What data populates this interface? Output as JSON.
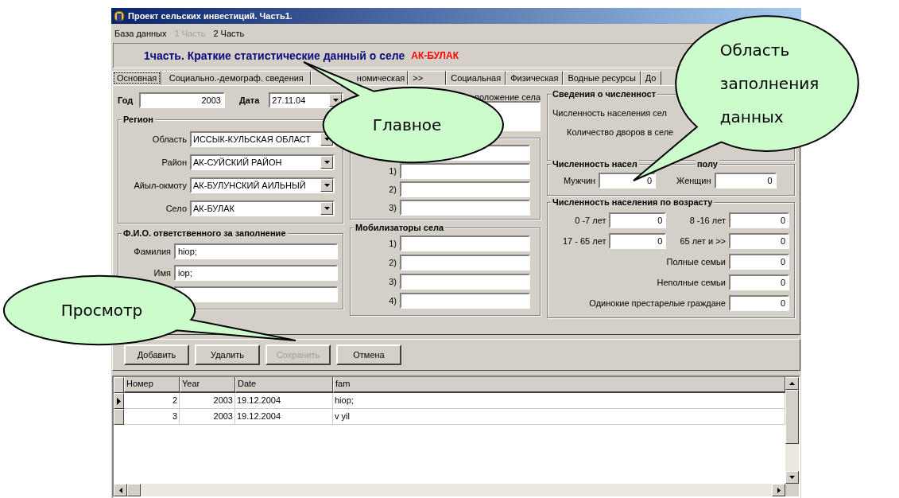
{
  "window": {
    "title": "Проект сельских инвестиций. Часть1."
  },
  "menu": [
    {
      "label": "База данных",
      "disabled": false
    },
    {
      "label": "1 Часть",
      "disabled": true
    },
    {
      "label": "2 Часть",
      "disabled": false
    }
  ],
  "header": {
    "text": "1часть. Краткие статистические данный о селе",
    "village": "АК-БУЛАК"
  },
  "tabs": [
    {
      "label": "Основная",
      "selected": true
    },
    {
      "label": "Социально.-демограф. сведения",
      "selected": false
    },
    {
      "label": "номическая",
      "selected": false
    },
    {
      "label": ">>",
      "selected": false
    },
    {
      "label": "Социальная",
      "selected": false
    },
    {
      "label": "Физическая",
      "selected": false
    },
    {
      "label": "Водные ресурсы",
      "selected": false
    },
    {
      "label": "До",
      "selected": false
    }
  ],
  "main": {
    "year": {
      "label": "Год",
      "value": "2003"
    },
    "date": {
      "label": "Дата",
      "value": "27.11.04"
    },
    "region": {
      "title": "Регион",
      "fields": [
        {
          "label": "Область",
          "value": "ИССЫК-КУЛЬСКАЯ ОБЛАСТ"
        },
        {
          "label": "Район",
          "value": "АК-СУЙСКИЙ РАЙОН"
        },
        {
          "label": "Айыл-окмоту",
          "value": "АК-БУЛУНСКИЙ АИЛЬНЫЙ"
        },
        {
          "label": "Село",
          "value": "АК-БУЛАК"
        }
      ]
    },
    "responsible": {
      "title": "Ф.И.О. ответственного за заполнение",
      "fields": [
        {
          "kind": "labeled",
          "label": "Фамилия",
          "value": "hiop;"
        },
        {
          "kind": "labeled",
          "label": "Имя",
          "value": "iop;"
        },
        {
          "kind": "blank"
        }
      ]
    },
    "location": {
      "label": "положение села"
    },
    "leaders": {
      "fields": [
        {
          "kind": "blank"
        },
        {
          "kind": "labeled",
          "label": "1)"
        },
        {
          "kind": "labeled",
          "label": "2)"
        },
        {
          "kind": "labeled",
          "label": "3)"
        }
      ]
    },
    "mobilizers": {
      "title": "Мобилизаторы села",
      "fields": [
        {
          "kind": "labeled",
          "label": "1)"
        },
        {
          "kind": "labeled",
          "label": "2)"
        },
        {
          "kind": "labeled",
          "label": "3)"
        },
        {
          "kind": "labeled",
          "label": "4)"
        }
      ]
    },
    "population": {
      "title": "Сведения о численност",
      "labels": [
        "Численность населения сел",
        "Количество дворов в селе"
      ]
    },
    "by_sex": {
      "title": "Численность насел",
      "title_end": "полу",
      "fields": [
        {
          "label": "Мужчин",
          "value": "0"
        },
        {
          "label": "Женщин",
          "value": "0"
        }
      ]
    },
    "by_age": {
      "title": "Численность населения по возрасту",
      "fields": [
        {
          "label": "0 -7 лет",
          "value": "0"
        },
        {
          "label": "8 -16 лет",
          "value": "0"
        },
        {
          "label": "17 - 65 лет",
          "value": "0"
        },
        {
          "label": "65 лет и >>",
          "value": "0"
        },
        {
          "label": "Полные семьи",
          "value": "0"
        },
        {
          "label": "Неполные семьи",
          "value": "0"
        },
        {
          "label": "Одинокие престарелые граждане",
          "value": "0"
        }
      ]
    }
  },
  "buttons": [
    {
      "label": "Добавить",
      "disabled": false
    },
    {
      "label": "Удалить",
      "disabled": false
    },
    {
      "label": "Сохранить",
      "disabled": true
    },
    {
      "label": "Отмена",
      "disabled": false
    }
  ],
  "table": {
    "columns": [
      "Номер",
      "Year",
      "Date",
      "fam"
    ],
    "rows": [
      {
        "cells": [
          "2",
          "2003",
          "19.12.2004",
          "hiop;"
        ],
        "selected": true
      },
      {
        "cells": [
          "3",
          "2003",
          "19.12.2004",
          "v yil"
        ],
        "selected": false
      }
    ]
  },
  "callouts": [
    {
      "text": "Главное"
    },
    {
      "text": "Область заполнения данных"
    },
    {
      "text": "Просмотр"
    }
  ]
}
